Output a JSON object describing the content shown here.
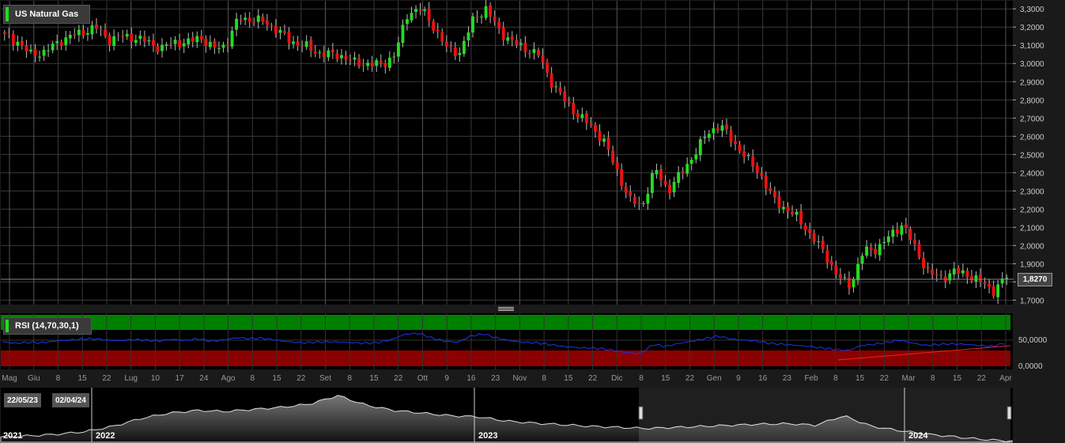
{
  "chart_data": [
    {
      "type": "candlestick",
      "title": "US Natural Gas",
      "last_price": "1,8270",
      "ylim": [
        1.68,
        3.34
      ],
      "y_ticks": [
        "3,3000",
        "3,2000",
        "3,1000",
        "3,0000",
        "2,9000",
        "2,8000",
        "2,7000",
        "2,6000",
        "2,5000",
        "2,4000",
        "2,3000",
        "2,2000",
        "2,1000",
        "2,0000",
        "1,9000",
        "1,8000",
        "1,7000"
      ],
      "colors": {
        "up": "#22dd22",
        "down": "#ee1111",
        "background": "#000000",
        "grid": "#3a3a3a"
      },
      "close_path": [
        3.15,
        3.12,
        3.05,
        3.06,
        3.11,
        3.15,
        3.17,
        3.2,
        3.13,
        3.15,
        3.14,
        3.12,
        3.08,
        3.12,
        3.11,
        3.15,
        3.08,
        3.1,
        3.25,
        3.24,
        3.23,
        3.18,
        3.12,
        3.1,
        3.06,
        3.05,
        3.04,
        3.0,
        3.0,
        2.99,
        3.05,
        3.28,
        3.3,
        3.2,
        3.08,
        3.06,
        3.24,
        3.3,
        3.18,
        3.12,
        3.08,
        3.05,
        2.9,
        2.8,
        2.72,
        2.66,
        2.58,
        2.42,
        2.25,
        2.22,
        2.42,
        2.3,
        2.4,
        2.5,
        2.62,
        2.66,
        2.57,
        2.48,
        2.4,
        2.26,
        2.2,
        2.15,
        2.05,
        1.96,
        1.83,
        1.78,
        1.97,
        1.98,
        2.05,
        2.12,
        1.98,
        1.85,
        1.82,
        1.86,
        1.84,
        1.8,
        1.75,
        1.83
      ]
    },
    {
      "type": "line",
      "title": "RSI (14,70,30,1)",
      "y_ticks": [
        "50,0000",
        "0,0000"
      ],
      "colors": {
        "line": "#2233ee",
        "overbought": "#008000",
        "oversold": "#8b0000",
        "trend": "#ee2222"
      },
      "values": [
        47,
        44,
        46,
        45,
        48,
        50,
        52,
        53,
        50,
        49,
        51,
        50,
        48,
        52,
        49,
        53,
        48,
        50,
        55,
        53,
        54,
        50,
        47,
        45,
        46,
        47,
        46,
        45,
        44,
        46,
        52,
        62,
        63,
        54,
        48,
        46,
        58,
        62,
        54,
        49,
        46,
        45,
        42,
        38,
        36,
        35,
        34,
        30,
        26,
        24,
        42,
        38,
        44,
        48,
        53,
        58,
        52,
        50,
        48,
        44,
        42,
        40,
        38,
        35,
        32,
        30,
        40,
        42,
        46,
        50,
        44,
        40,
        42,
        43,
        42,
        40,
        38,
        44
      ]
    }
  ],
  "x_axis": {
    "ticks": [
      "Mag",
      "Giu",
      "8",
      "15",
      "22",
      "Lug",
      "10",
      "17",
      "24",
      "Ago",
      "8",
      "15",
      "22",
      "Set",
      "8",
      "15",
      "22",
      "Ott",
      "9",
      "16",
      "23",
      "Nov",
      "8",
      "15",
      "22",
      "Dic",
      "8",
      "15",
      "22",
      "Gen",
      "9",
      "16",
      "23",
      "Feb",
      "8",
      "15",
      "22",
      "Mar",
      "8",
      "15",
      "22",
      "Apr"
    ],
    "months": [
      "Mag",
      "Giu",
      "Lug",
      "Ago",
      "Set",
      "Ott",
      "Nov",
      "Dic",
      "Gen",
      "Feb",
      "Mar",
      "Apr"
    ]
  },
  "navigator": {
    "start_date": "22/05/23",
    "end_date": "02/04/24",
    "years": [
      "2021",
      "2022",
      "2023",
      "2024"
    ]
  }
}
